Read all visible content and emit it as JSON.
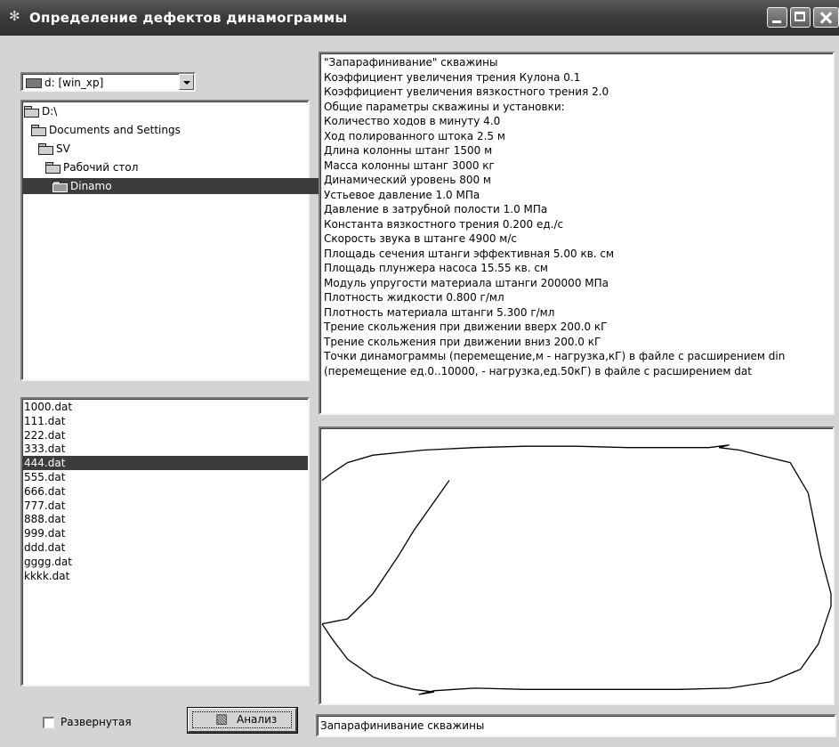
{
  "window": {
    "title": "Определение дефектов динамограммы"
  },
  "drive": {
    "value": "d: [win_xp]"
  },
  "directories": [
    {
      "label": "D:\\",
      "level": 0
    },
    {
      "label": "Documents and Settings",
      "level": 1
    },
    {
      "label": "SV",
      "level": 2
    },
    {
      "label": "Рабочий стол",
      "level": 3
    },
    {
      "label": "Dinamo",
      "level": 4,
      "selected": true
    }
  ],
  "files": {
    "items": [
      "1000.dat",
      "111.dat",
      "222.dat",
      "333.dat",
      "444.dat",
      "555.dat",
      "666.dat",
      "777.dat",
      "888.dat",
      "999.dat",
      "ddd.dat",
      "gggg.dat",
      "kkkk.dat"
    ],
    "selected": "444.dat"
  },
  "controls": {
    "expanded_label": "Развернутая",
    "expanded_checked": false,
    "analyze_label": "Анализ"
  },
  "params": {
    "lines": [
      "\"Запарафинивание\" скважины",
      "  Коэффициент увеличения трения Кулона 0.1",
      "  Коэффициент увеличения вязкостного трения 2.0",
      "Общие параметры скважины и установки:",
      "  Количество ходов в минуту 4.0",
      "  Ход полированного штока 2.5 м",
      "  Длина колонны штанг 1500 м",
      "  Масса колонны штанг 3000 кг",
      "  Динамический уровень  800 м",
      "  Устьевое давление 1.0 МПа",
      "  Давление в затрубной полости 1.0 МПа",
      "  Константа вязкостного трения 0.200 ед./с",
      "  Скорость звука в штанге 4900 м/с",
      "  Площадь сечения штанги эффективная 5.00 кв. см",
      "  Площадь плунжера насоса 15.55 кв. см",
      "  Модуль упругости материала штанги 200000 МПа",
      "  Плотность жидкости 0.800 г/мл",
      "  Плотность материала штанги 5.300 г/мл",
      "  Трение скольжения при движении вверх 200.0 кГ",
      "  Трение скольжения при движении вниз 200.0 кГ",
      "Точки динамограммы (перемещение,м - нагрузка,кГ) в файле с расширением din",
      "   (перемещение ед.0..10000, - нагрузка,ед.50кГ) в файле с расширением dat"
    ]
  },
  "result": {
    "text": "Запарафинивание скважины"
  },
  "chart_data": {
    "type": "line",
    "title": "",
    "xlabel": "",
    "ylabel": "",
    "grid": false,
    "series": [
      {
        "x": [
          0.0,
          0.02,
          0.05,
          0.1,
          0.14,
          0.18,
          0.22,
          0.19,
          0.22,
          0.26,
          0.3,
          0.4,
          0.5,
          0.6,
          0.7,
          0.8,
          0.88,
          0.94,
          0.975,
          1.0,
          1.0,
          0.98,
          0.955,
          0.92,
          0.86,
          0.82,
          0.78,
          0.8,
          0.76,
          0.7,
          0.6,
          0.5,
          0.4,
          0.3,
          0.2,
          0.1,
          0.05,
          0.02,
          0.0
        ],
        "y": [
          0.28,
          0.22,
          0.14,
          0.07,
          0.04,
          0.02,
          0.01,
          0.0,
          0.015,
          0.02,
          0.025,
          0.02,
          0.02,
          0.02,
          0.02,
          0.025,
          0.05,
          0.1,
          0.2,
          0.35,
          0.4,
          0.55,
          0.8,
          0.92,
          0.95,
          0.97,
          0.98,
          0.99,
          0.98,
          0.98,
          0.98,
          0.985,
          0.985,
          0.98,
          0.97,
          0.95,
          0.92,
          0.88,
          0.85
        ],
        "x_closing": [
          0.0,
          0.05,
          0.1,
          0.15,
          0.18,
          0.25
        ],
        "y_closing": [
          0.28,
          0.3,
          0.4,
          0.55,
          0.65,
          0.85
        ]
      }
    ]
  }
}
